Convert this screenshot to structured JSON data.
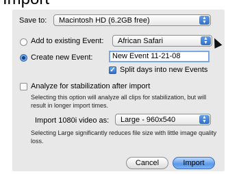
{
  "top_text": "Import",
  "save_to": {
    "label": "Save to:",
    "value": "Macintosh HD (6.2GB free)"
  },
  "event": {
    "add_existing_label": "Add to existing Event:",
    "existing_value": "African Safari",
    "create_new_label": "Create new Event:",
    "new_event_value": "New Event 11-21-08",
    "split_days_label": "Split days into new Events"
  },
  "stabilization": {
    "label": "Analyze for stabilization after import",
    "help": "Selecting this option will analyze all clips for stabilization, but will result in longer import times."
  },
  "video": {
    "label": "Import 1080i video as:",
    "value": "Large - 960x540",
    "help": "Selecting Large significantly reduces file size with little image quality loss."
  },
  "buttons": {
    "cancel": "Cancel",
    "import": "Import"
  },
  "state": {
    "create_new_selected": true,
    "split_days_checked": true,
    "analyze_checked": false
  }
}
